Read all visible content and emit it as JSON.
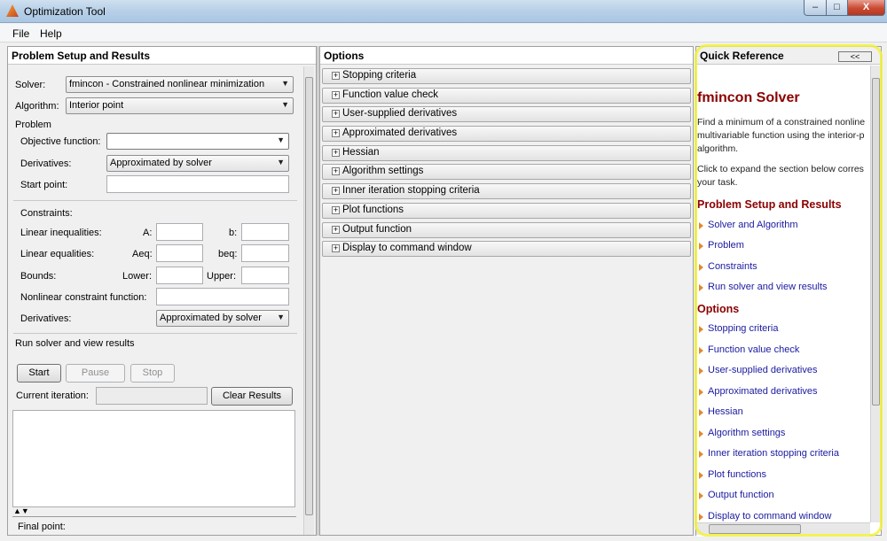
{
  "window": {
    "title": "Optimization Tool",
    "buttons": {
      "minimize": "–",
      "maximize": "□",
      "close": "X"
    }
  },
  "menu": [
    "File",
    "Help"
  ],
  "setup": {
    "header": "Problem Setup and Results",
    "solver_label": "Solver:",
    "solver_value": "fmincon - Constrained nonlinear minimization",
    "algorithm_label": "Algorithm:",
    "algorithm_value": "Interior point",
    "problem_label": "Problem",
    "objective_label": "Objective function:",
    "objective_value": "",
    "derivatives_label": "Derivatives:",
    "derivatives_value": "Approximated by solver",
    "start_point_label": "Start point:",
    "constraints_label": "Constraints:",
    "linear_ineq_label": "Linear inequalities:",
    "A_label": "A:",
    "b_label": "b:",
    "linear_eq_label": "Linear equalities:",
    "Aeq_label": "Aeq:",
    "beq_label": "beq:",
    "bounds_label": "Bounds:",
    "lower_label": "Lower:",
    "upper_label": "Upper:",
    "nonlinear_label": "Nonlinear constraint function:",
    "derivatives2_label": "Derivatives:",
    "derivatives2_value": "Approximated by solver",
    "run_label": "Run solver and view results",
    "start_btn": "Start",
    "pause_btn": "Pause",
    "stop_btn": "Stop",
    "current_iter_label": "Current iteration:",
    "clear_btn": "Clear Results",
    "final_point_label": "Final point:"
  },
  "options": {
    "header": "Options",
    "items": [
      "Stopping criteria",
      "Function value check",
      "User-supplied derivatives",
      "Approximated derivatives",
      "Hessian",
      "Algorithm settings",
      "Inner iteration stopping criteria",
      "Plot functions",
      "Output function",
      "Display to command window"
    ]
  },
  "quickref": {
    "header": "Quick Reference",
    "collapse": "<<",
    "title": "fmincon Solver",
    "intro_1": "Find a minimum of a constrained nonline",
    "intro_2": "multivariable function using the interior-p",
    "intro_3": "algorithm.",
    "click_1": "Click to expand the section below corres",
    "click_2": "your task.",
    "section_setup": "Problem Setup and Results",
    "setup_links": [
      "Solver and Algorithm",
      "Problem",
      "Constraints",
      "Run solver and view results"
    ],
    "section_options": "Options",
    "option_links": [
      "Stopping criteria",
      "Function value check",
      "User-supplied derivatives",
      "Approximated derivatives",
      "Hessian",
      "Algorithm settings",
      "Inner iteration stopping criteria",
      "Plot functions",
      "Output function",
      "Display to command window"
    ]
  },
  "colors": {
    "section_red": "#8b0000",
    "link_blue": "#1a1aa0",
    "highlight_yellow": "#f2f23a"
  }
}
